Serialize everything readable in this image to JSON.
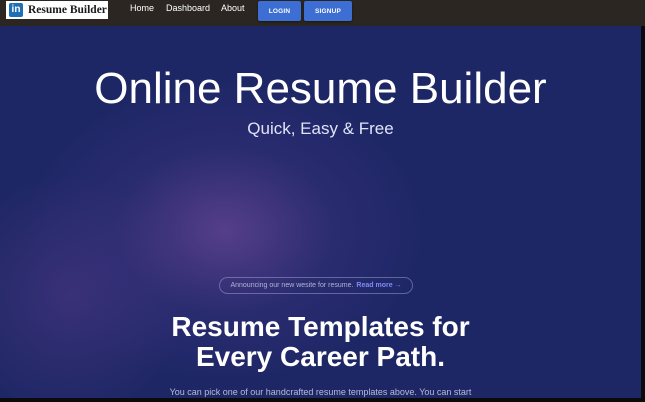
{
  "navbar": {
    "logo": {
      "badge": "in",
      "text": "Resume Builder"
    },
    "links": [
      "Home",
      "Dashboard",
      "About"
    ],
    "login_label": "LOGIN",
    "signup_label": "SIGNUP"
  },
  "hero": {
    "title": "Online Resume Builder",
    "subtitle": "Quick, Easy & Free"
  },
  "announcement": {
    "text": "Announcing our new wesite for resume.",
    "link": "Read more →"
  },
  "section": {
    "title_line1": "Resume Templates for",
    "title_line2": "Every Career Path.",
    "body": "You can pick one of our handcrafted resume templates above. You can start"
  },
  "colors": {
    "navbar": "#2b2622",
    "hero_background": "#1e2766",
    "button": "#3c6ed3",
    "link_accent": "#7f8cf5"
  }
}
